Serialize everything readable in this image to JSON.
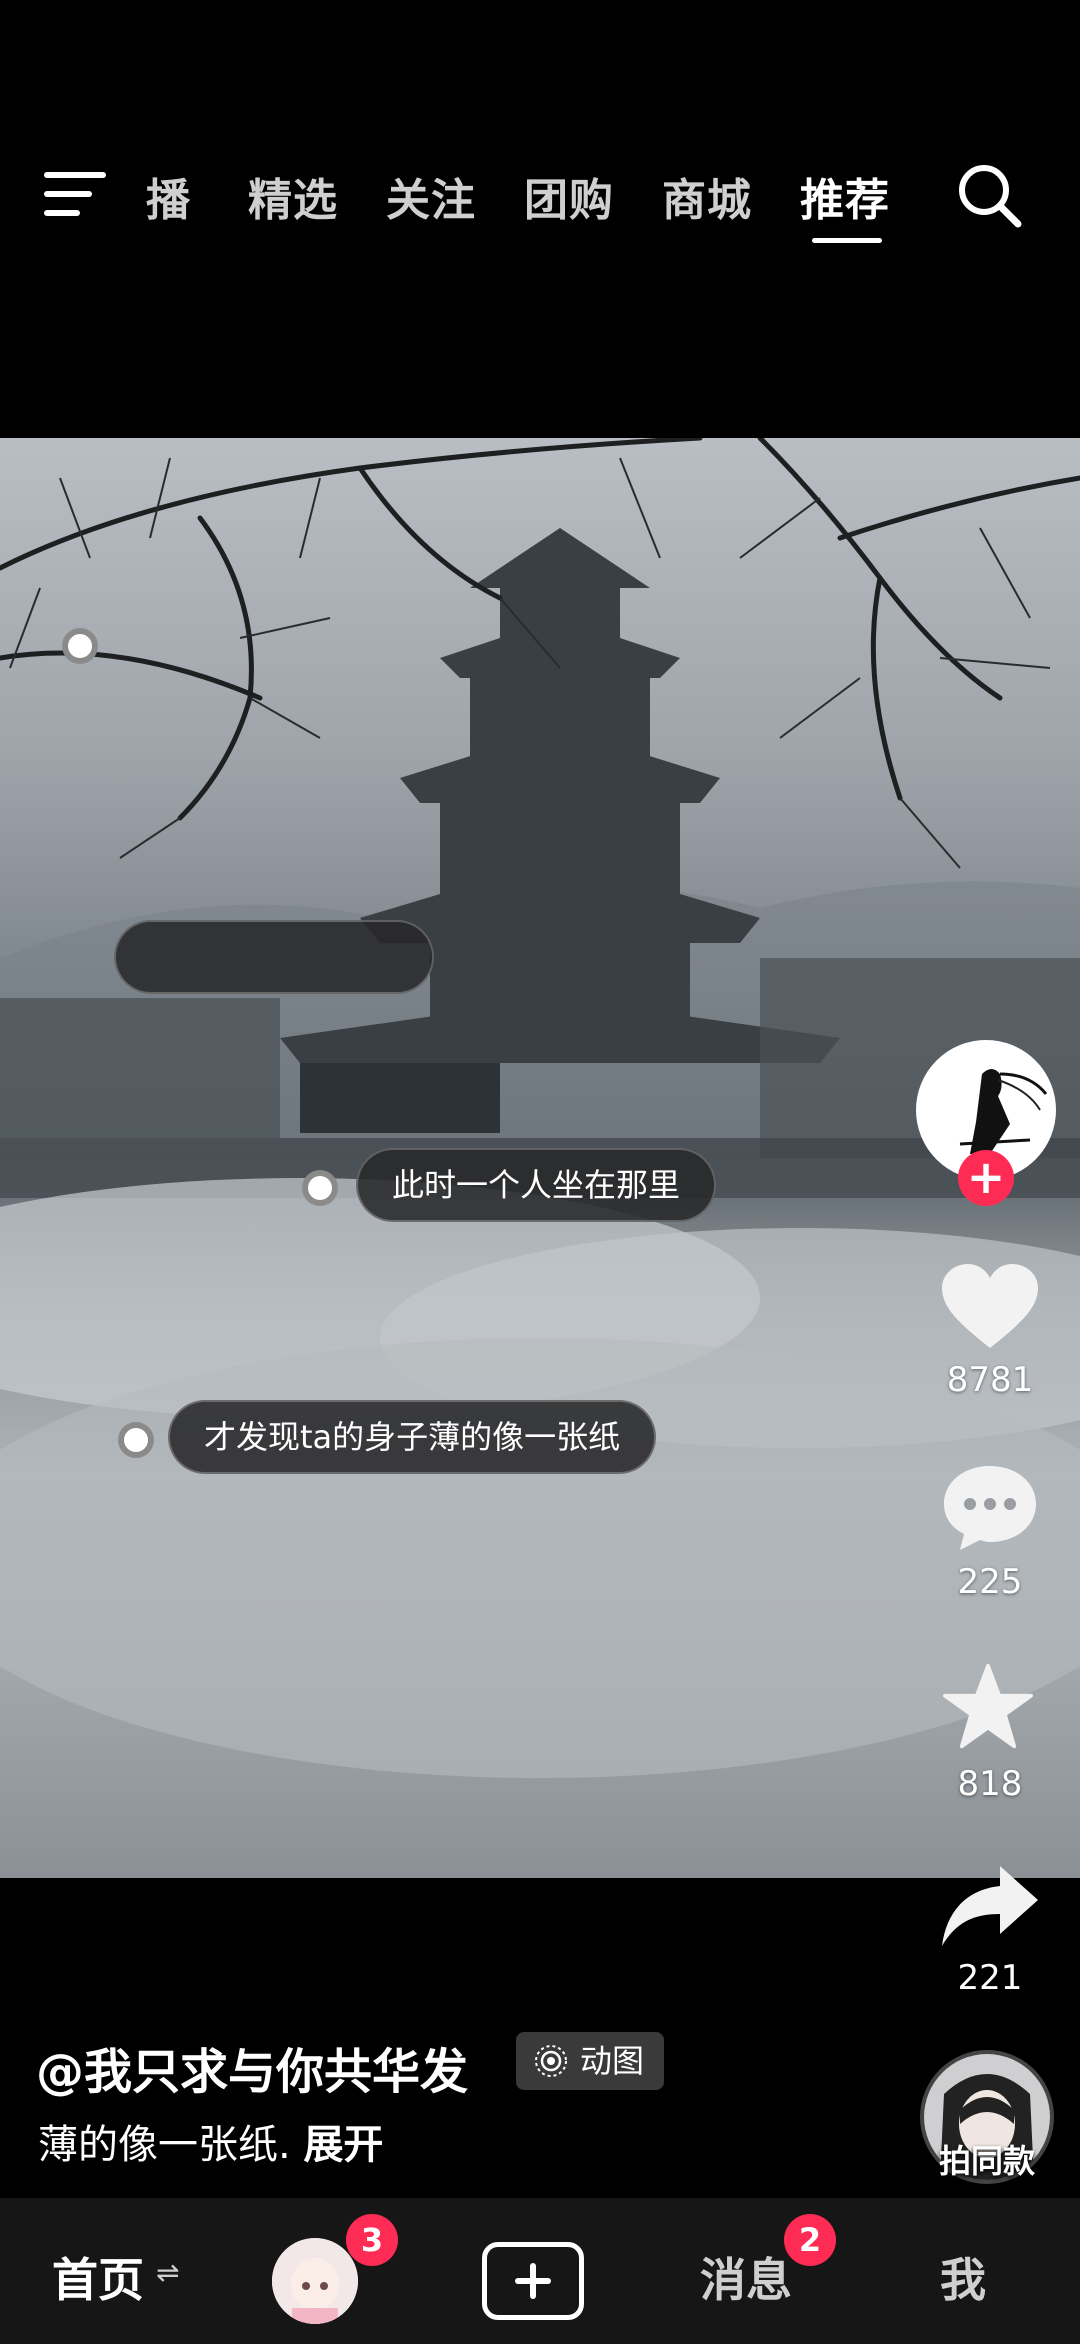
{
  "top_nav": {
    "tabs": [
      {
        "label": "播"
      },
      {
        "label": "精选"
      },
      {
        "label": "关注"
      },
      {
        "label": "团购"
      },
      {
        "label": "商城"
      },
      {
        "label": "推荐"
      }
    ],
    "active_tab": "推荐",
    "menu_icon": "hamburger-menu-icon",
    "search_icon": "search-icon"
  },
  "video": {
    "bubbles": [
      {
        "text": ""
      },
      {
        "text": "此时一个人坐在那里"
      },
      {
        "text": "才发现ta的身子薄的像一张纸"
      }
    ]
  },
  "right_rail": {
    "follow_symbol": "+",
    "likes": "8781",
    "comments": "225",
    "favorites": "818",
    "shares": "221",
    "music_label": "拍同款",
    "colors": {
      "follow": "#fe2c55"
    }
  },
  "caption": {
    "author": "@我只求与你共华发",
    "badge": "动图",
    "description": "薄的像一张纸.",
    "expand": "展开"
  },
  "bottom_nav": {
    "home": "首页",
    "friends_badge": "3",
    "messages": "消息",
    "messages_badge": "2",
    "me": "我"
  }
}
